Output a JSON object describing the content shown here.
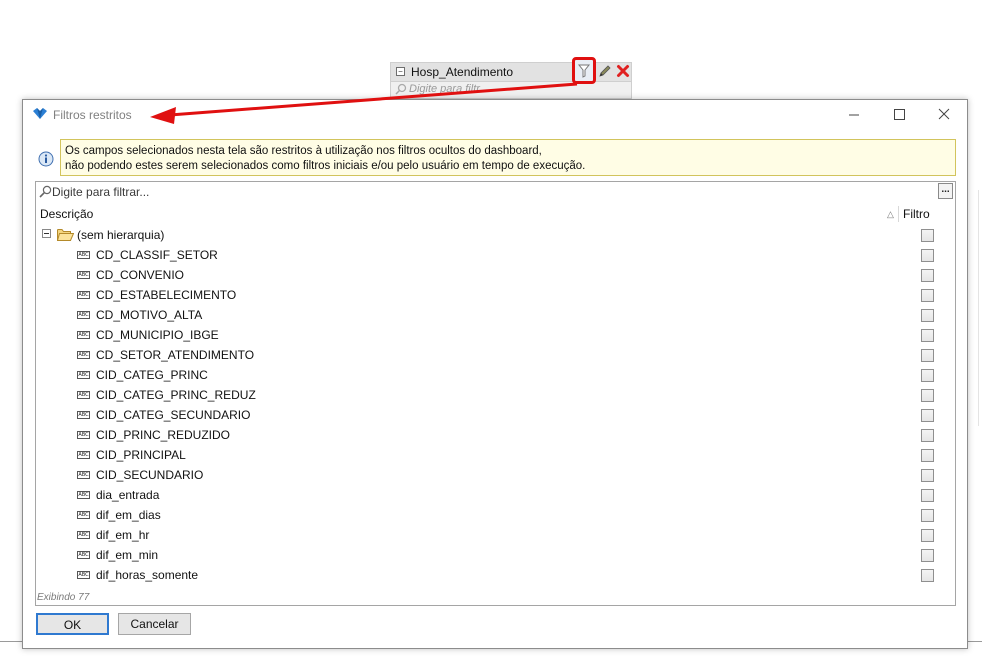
{
  "background_widget": {
    "title": "Hosp_Atendimento",
    "search_placeholder": "Digite para filtrar...",
    "search_visible_text": "Digite para filtr..."
  },
  "dialog": {
    "title": "Filtros restritos",
    "info_line1": "Os campos selecionados nesta tela são restritos à utilização nos filtros ocultos do dashboard,",
    "info_line2": "não podendo estes serem selecionados como filtros iniciais e/ou pelo usuário em tempo de execução.",
    "filter_placeholder": "Digite para filtrar...",
    "ellipsis_label": "...",
    "columns": {
      "description": "Descrição",
      "filter": "Filtro"
    },
    "root_label": "(sem hierarquia)",
    "fields": [
      "CD_CLASSIF_SETOR",
      "CD_CONVENIO",
      "CD_ESTABELECIMENTO",
      "CD_MOTIVO_ALTA",
      "CD_MUNICIPIO_IBGE",
      "CD_SETOR_ATENDIMENTO",
      "CID_CATEG_PRINC",
      "CID_CATEG_PRINC_REDUZ",
      "CID_CATEG_SECUNDARIO",
      "CID_PRINC_REDUZIDO",
      "CID_PRINCIPAL",
      "CID_SECUNDARIO",
      "dia_entrada",
      "dif_em_dias",
      "dif_em_hr",
      "dif_em_min",
      "dif_horas_somente"
    ],
    "field_type_badge": "ABC",
    "status": "Exibindo 77",
    "ok_label": "OK",
    "cancel_label": "Cancelar"
  },
  "colors": {
    "highlight_red": "#e01010",
    "info_background": "#fffde5",
    "ok_border": "#2f79d0"
  }
}
